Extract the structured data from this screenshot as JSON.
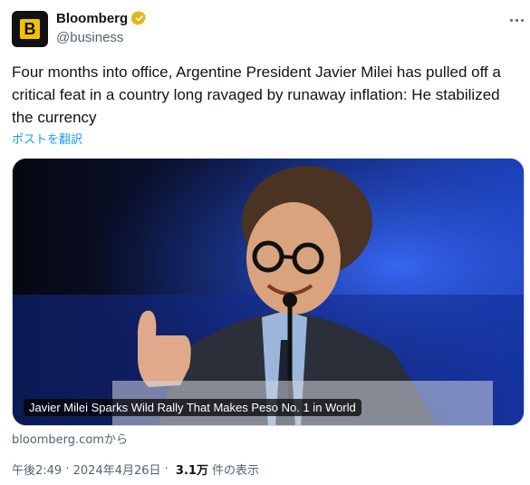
{
  "author": {
    "display_name": "Bloomberg",
    "handle": "@business",
    "avatar_letter": "B",
    "verified_badge_color": "#e2b719"
  },
  "tweet": {
    "text": "Four months into office, Argentine President Javier Milei has pulled off a critical feat in a country long ravaged by runaway inflation: He stabilized the currency",
    "translate_label": "ポストを翻訳"
  },
  "card": {
    "headline": "Javier Milei Sparks Wild Rally That Makes Peso No. 1 in World",
    "source": "bloomberg.comから"
  },
  "meta": {
    "time": "午後2:49",
    "separator1": " · ",
    "date": "2024年4月26日",
    "separator2": " · ",
    "views_count": "3.1万",
    "views_label": "件の表示"
  },
  "colors": {
    "link": "#1d9bf0",
    "secondary_text": "#536471",
    "primary_text": "#0f1419"
  }
}
